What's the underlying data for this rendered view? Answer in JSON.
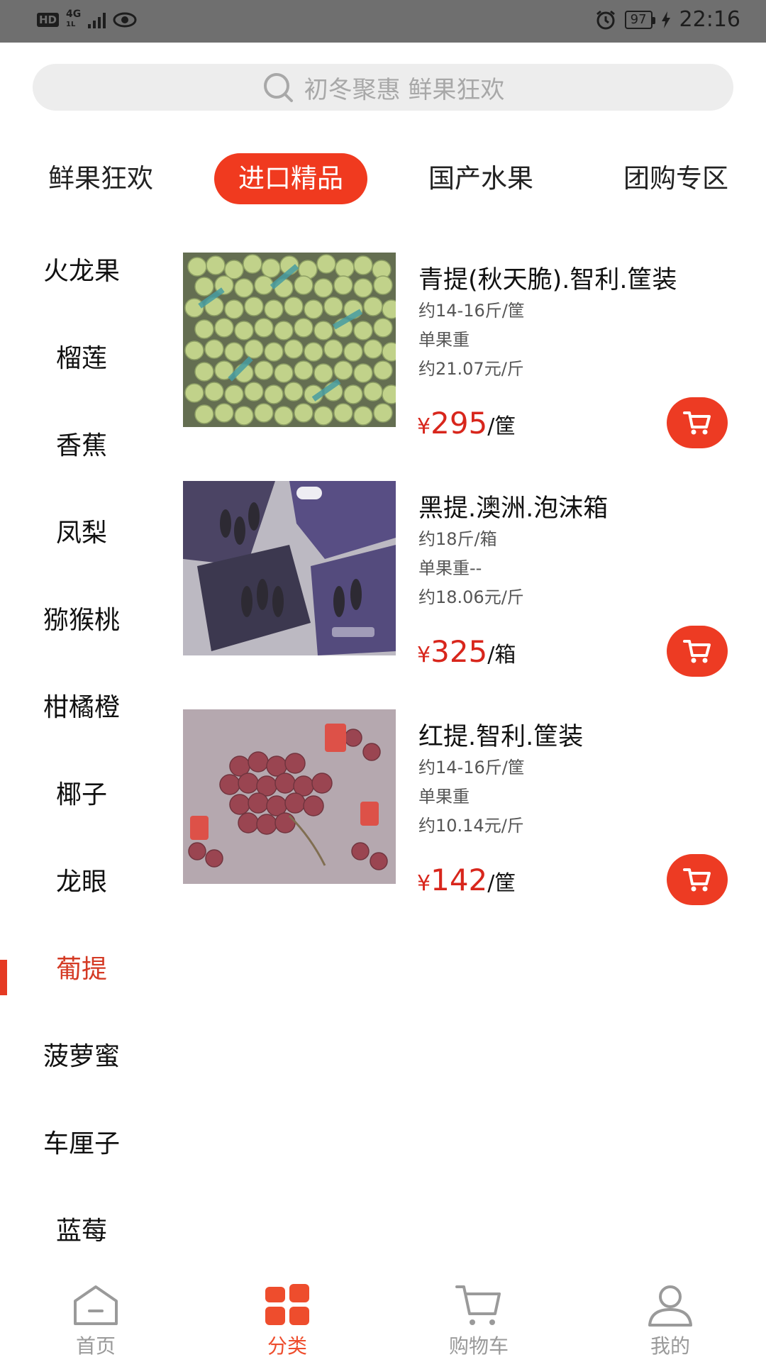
{
  "status_bar": {
    "hd": "HD",
    "network": "4G",
    "network_sub": "1L",
    "battery": "97",
    "time": "22:16"
  },
  "search": {
    "placeholder": "初冬聚惠 鲜果狂欢"
  },
  "tabs": [
    {
      "label": "鲜果狂欢",
      "active": false
    },
    {
      "label": "进口精品",
      "active": true
    },
    {
      "label": "国产水果",
      "active": false
    },
    {
      "label": "团购专区",
      "active": false
    }
  ],
  "sidebar": {
    "items": [
      "火龙果",
      "榴莲",
      "香蕉",
      "凤梨",
      "猕猴桃",
      "柑橘橙",
      "椰子",
      "龙眼",
      "葡提",
      "菠萝蜜",
      "车厘子",
      "蓝莓"
    ],
    "active": "葡提"
  },
  "products": [
    {
      "name": "青提(秋天脆).智利.筐装",
      "spec": "约14-16斤/筐",
      "weight": "单果重",
      "unit_price": "约21.07元/斤",
      "currency": "¥",
      "price": "295",
      "unit": "/筐",
      "image": "green-grapes"
    },
    {
      "name": "黑提.澳洲.泡沫箱",
      "spec": "约18斤/箱",
      "weight": "单果重--",
      "unit_price": "约18.06元/斤",
      "currency": "¥",
      "price": "325",
      "unit": "/箱",
      "image": "black-grapes"
    },
    {
      "name": "红提.智利.筐装",
      "spec": "约14-16斤/筐",
      "weight": "单果重",
      "unit_price": "约10.14元/斤",
      "currency": "¥",
      "price": "142",
      "unit": "/筐",
      "image": "red-grapes"
    }
  ],
  "bottom_nav": [
    {
      "label": "首页",
      "icon": "home-icon",
      "active": false
    },
    {
      "label": "分类",
      "icon": "category-icon",
      "active": true
    },
    {
      "label": "购物车",
      "icon": "cart-icon",
      "active": false
    },
    {
      "label": "我的",
      "icon": "profile-icon",
      "active": false
    }
  ],
  "colors": {
    "accent": "#f03a1f",
    "price": "#d8261c",
    "nav_inactive": "#9a9a9a",
    "status_bar": "#6f6f6f"
  }
}
